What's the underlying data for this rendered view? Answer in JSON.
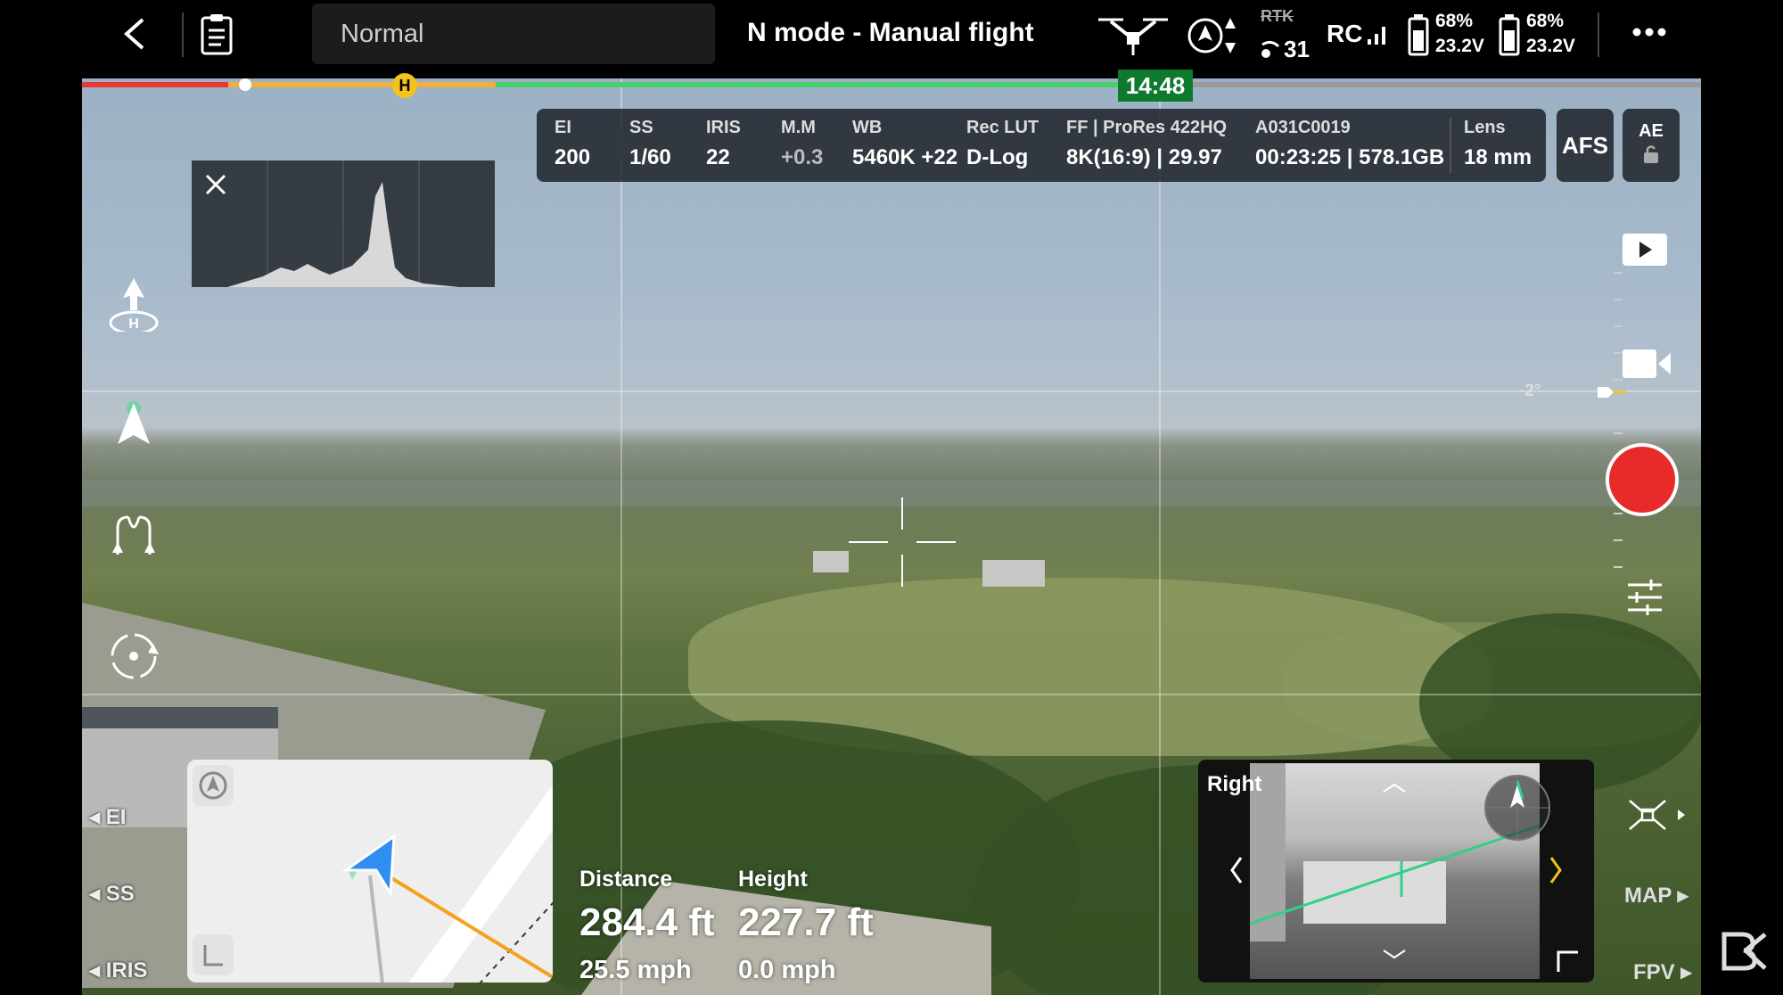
{
  "topbar": {
    "mode": "Normal",
    "flight_mode": "N mode - Manual flight",
    "rtk": "RTK",
    "satellites": "31",
    "rc": "RC",
    "battery1": {
      "percent": "68%",
      "voltage": "23.2V"
    },
    "battery2": {
      "percent": "68%",
      "voltage": "23.2V"
    }
  },
  "progress": {
    "time": "14:48",
    "home_marker": "H"
  },
  "camera": {
    "params": [
      {
        "label": "EI",
        "value": "200"
      },
      {
        "label": "SS",
        "value": "1/60"
      },
      {
        "label": "IRIS",
        "value": "22"
      },
      {
        "label": "M.M",
        "value": "+0.3"
      },
      {
        "label": "WB",
        "value": "5460K +22"
      },
      {
        "label": "Rec LUT",
        "value": "D-Log"
      },
      {
        "label": "FF | ProRes 422HQ",
        "value": "8K(16:9) | 29.97"
      },
      {
        "label": "A031C0019",
        "value": "00:23:25 | 578.1GB"
      },
      {
        "label": "Lens",
        "value": "18 mm"
      }
    ],
    "afs_label": "AFS",
    "ae_label": "AE"
  },
  "gimbal": {
    "angle": "-2°"
  },
  "telemetry": {
    "distance_label": "Distance",
    "distance": "284.4 ft",
    "horizontal_speed": "25.5 mph",
    "height_label": "Height",
    "height": "227.7 ft",
    "vertical_speed": "0.0 mph"
  },
  "bottom_left": {
    "ei": "EI",
    "ss": "SS",
    "iris": "IRIS"
  },
  "fpv": {
    "label": "Right"
  },
  "right_labels": {
    "map": "MAP",
    "fpv": "FPV"
  },
  "icons": [
    "back-icon",
    "checklist-icon",
    "drone-icon",
    "obstacle-icon",
    "rtk-signal-icon",
    "rc-signal-icon",
    "battery-icon",
    "more-icon",
    "takeoff-icon",
    "navigation-arrow-icon",
    "waypoint-icon",
    "poi-icon",
    "play-icon",
    "camera-mode-icon",
    "settings-sliders-icon",
    "close-icon",
    "compass-icon",
    "lock-icon",
    "watermark-logo"
  ]
}
